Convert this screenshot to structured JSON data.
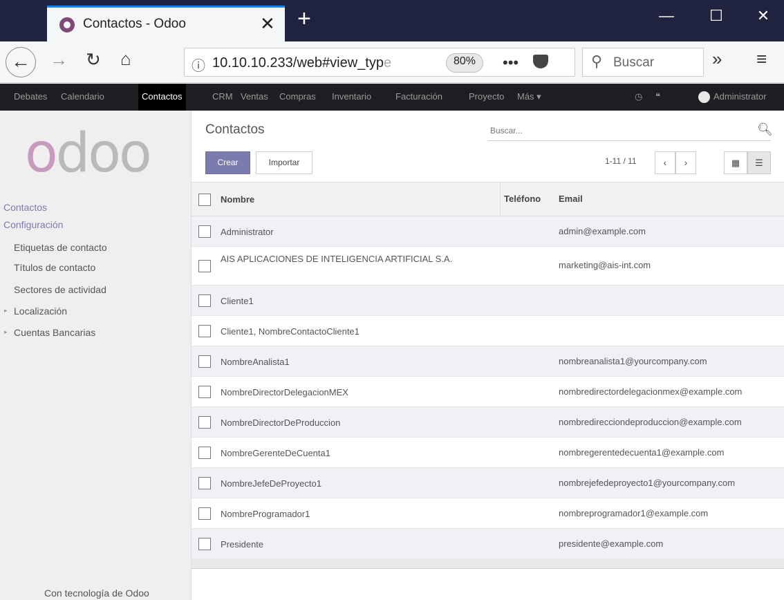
{
  "browser": {
    "tab_title": "Contactos - Odoo",
    "url_main": "10.10.10.233/web#view_typ",
    "url_faded": "e",
    "zoom": "80%",
    "dots": "•••",
    "search_placeholder": "Buscar",
    "new_tab": "+",
    "overflow": "»",
    "menu": "≡"
  },
  "topmenu": {
    "items": [
      "Debates",
      "Calendario",
      "Contactos",
      "CRM",
      "Ventas",
      "Compras",
      "Inventario",
      "Facturación",
      "Proyecto",
      "Más ▾"
    ],
    "active": "Contactos",
    "user": "Administrator"
  },
  "sidebar": {
    "heading_1": "Contactos",
    "heading_2": "Configuración",
    "items": [
      "Etiquetas de contacto",
      "Títulos de contacto",
      "Sectores de actividad",
      "Localización",
      "Cuentas Bancarias"
    ],
    "powered_by": "Con tecnología de Odoo"
  },
  "control_panel": {
    "title": "Contactos",
    "search_placeholder": "Buscar...",
    "create_label": "Crear",
    "import_label": "Importar",
    "pager": "1-11 / 11"
  },
  "table": {
    "headers": {
      "name": "Nombre",
      "phone": "Teléfono",
      "email": "Email"
    },
    "rows": [
      {
        "name": "Administrator",
        "phone": "",
        "email": "admin@example.com"
      },
      {
        "name": "AIS APLICACIONES DE INTELIGENCIA ARTIFICIAL S.A.",
        "phone": "",
        "email": "marketing@ais-int.com"
      },
      {
        "name": "Cliente1",
        "phone": "",
        "email": ""
      },
      {
        "name": "Cliente1, NombreContactoCliente1",
        "phone": "",
        "email": ""
      },
      {
        "name": "NombreAnalista1",
        "phone": "",
        "email": "nombreanalista1@yourcompany.com"
      },
      {
        "name": "NombreDirectorDelegacionMEX",
        "phone": "",
        "email": "nombredirectordelegacionmex@example.com"
      },
      {
        "name": "NombreDirectorDeProduccion",
        "phone": "",
        "email": "nombredirecciondeproduccion@example.com"
      },
      {
        "name": "NombreGerenteDeCuenta1",
        "phone": "",
        "email": "nombregerentedecuenta1@example.com"
      },
      {
        "name": "NombreJefeDeProyecto1",
        "phone": "",
        "email": "nombrejefedeproyecto1@yourcompany.com"
      },
      {
        "name": "NombreProgramador1",
        "phone": "",
        "email": "nombreprogramador1@example.com"
      },
      {
        "name": "Presidente",
        "phone": "",
        "email": "presidente@example.com"
      }
    ]
  },
  "colors": {
    "primary": "#7c7bad",
    "menu_bg": "#1d1e21",
    "sidebar_bg": "#f0eeee"
  }
}
